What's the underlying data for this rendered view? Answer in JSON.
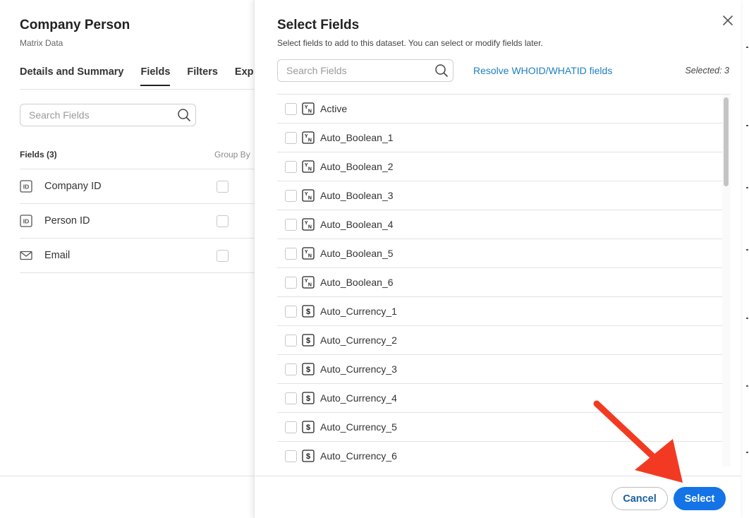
{
  "background": {
    "title": "Company Person",
    "subtitle": "Matrix Data",
    "tabs": [
      {
        "label": "Details and Summary",
        "active": false
      },
      {
        "label": "Fields",
        "active": true
      },
      {
        "label": "Filters",
        "active": false
      },
      {
        "label": "Expo",
        "active": false
      }
    ],
    "search_placeholder": "Search Fields",
    "fields_header": "Fields (3)",
    "group_by_header": "Group By",
    "fields": [
      {
        "label": "Company ID",
        "icon": "id-icon"
      },
      {
        "label": "Person ID",
        "icon": "id-icon"
      },
      {
        "label": "Email",
        "icon": "envelope-icon"
      }
    ]
  },
  "dialog": {
    "title": "Select Fields",
    "subtitle": "Select fields to add to this dataset. You can select or modify fields later.",
    "search_placeholder": "Search Fields",
    "resolve_link": "Resolve WHOID/WHATID fields",
    "selected_count": "Selected: 3",
    "items": [
      {
        "name": "Active",
        "type": "boolean"
      },
      {
        "name": "Auto_Boolean_1",
        "type": "boolean"
      },
      {
        "name": "Auto_Boolean_2",
        "type": "boolean"
      },
      {
        "name": "Auto_Boolean_3",
        "type": "boolean"
      },
      {
        "name": "Auto_Boolean_4",
        "type": "boolean"
      },
      {
        "name": "Auto_Boolean_5",
        "type": "boolean"
      },
      {
        "name": "Auto_Boolean_6",
        "type": "boolean"
      },
      {
        "name": "Auto_Currency_1",
        "type": "currency"
      },
      {
        "name": "Auto_Currency_2",
        "type": "currency"
      },
      {
        "name": "Auto_Currency_3",
        "type": "currency"
      },
      {
        "name": "Auto_Currency_4",
        "type": "currency"
      },
      {
        "name": "Auto_Currency_5",
        "type": "currency"
      },
      {
        "name": "Auto_Currency_6",
        "type": "currency"
      }
    ],
    "cancel_label": "Cancel",
    "select_label": "Select"
  },
  "colors": {
    "accent": "#1473e6",
    "link": "#1f7fc1",
    "annotation_arrow": "#f23a22"
  }
}
